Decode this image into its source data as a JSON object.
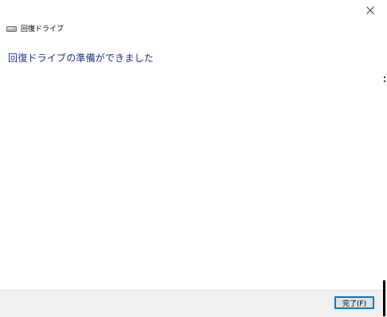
{
  "window": {
    "title": "回復ドライブ",
    "title_icon": "drive-icon",
    "close_icon": "close-icon"
  },
  "main": {
    "heading": "回復ドライブの準備ができました"
  },
  "footer": {
    "finish_label": "完了(F)"
  },
  "colors": {
    "heading": "#1e3287",
    "footer_background": "#f0f0f0",
    "button_border": "#0078d7",
    "button_background": "#e1e1e1"
  }
}
